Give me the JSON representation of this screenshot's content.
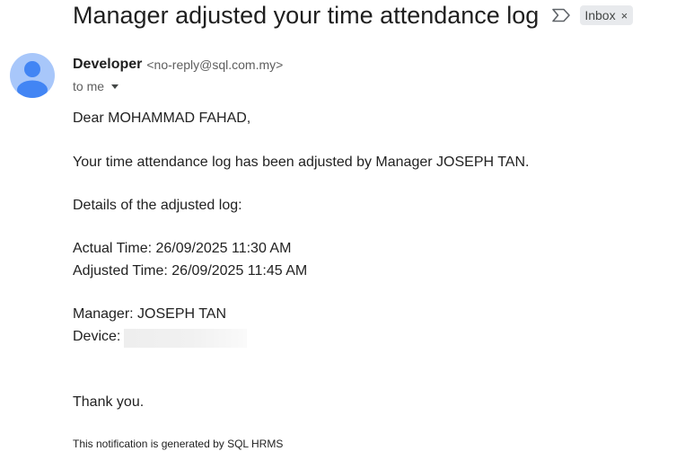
{
  "email": {
    "subject": "Manager adjusted your time attendance log",
    "label": "Inbox",
    "label_remove": "×",
    "sender_name": "Developer",
    "sender_email": "<no-reply@sql.com.my>",
    "recipient": "to me"
  },
  "body": {
    "greeting": "Dear MOHAMMAD FAHAD,",
    "message": "Your time attendance log has been adjusted by Manager JOSEPH TAN.",
    "details_heading": "Details of the adjusted log:",
    "actual_time": "Actual Time: 26/09/2025 11:30 AM",
    "adjusted_time": "Adjusted Time: 26/09/2025 11:45 AM",
    "manager": "Manager: JOSEPH TAN",
    "device_label": "Device:",
    "closing": "Thank you.",
    "footer": "This notification is generated by SQL HRMS"
  },
  "colors": {
    "avatar_bg": "#a8c7fa",
    "avatar_fg": "#4285f4",
    "chip_bg": "#e8eaed"
  },
  "icons": {
    "important": "important-marker-icon",
    "avatar": "default-avatar-icon",
    "caret": "caret-down-icon"
  }
}
